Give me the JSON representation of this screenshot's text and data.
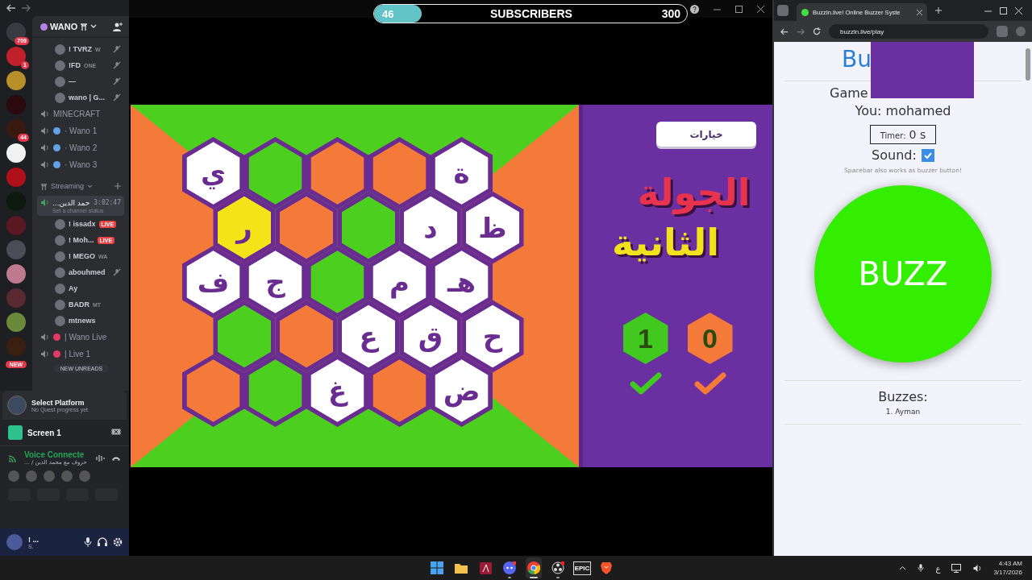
{
  "discord": {
    "server_name": "WANO",
    "servers": [
      {
        "color": "#3a3b40",
        "badge": "709"
      },
      {
        "color": "#c0202a",
        "badge": "1"
      },
      {
        "color": "#b8902a"
      },
      {
        "color": "#2a0a0c"
      },
      {
        "color": "#3a1a10",
        "badge": "44"
      },
      {
        "color": "#f2f2f2"
      },
      {
        "color": "#b0101a"
      },
      {
        "color": "#0e1a10"
      },
      {
        "color": "#5a1820"
      },
      {
        "color": "#4a4d56"
      },
      {
        "color": "#c07a90"
      },
      {
        "color": "#5a2a30"
      },
      {
        "color": "#6a8a3a"
      },
      {
        "color": "#3a2010"
      }
    ],
    "new_pill": "NEW",
    "rows": [
      {
        "kind": "user",
        "name": "! TVRZ",
        "tag": "W",
        "muted": true
      },
      {
        "kind": "user",
        "name": "!FD",
        "tag": "ONE",
        "muted": true
      },
      {
        "kind": "user",
        "name": "—",
        "muted": true
      },
      {
        "kind": "user",
        "name": "wano | G...",
        "muted": true
      },
      {
        "kind": "voice",
        "name": "MINECRAFT"
      },
      {
        "kind": "voice",
        "name": "· Wano 1",
        "color": "#5fa3e6"
      },
      {
        "kind": "voice",
        "name": "· Wano 2",
        "color": "#5fa3e6"
      },
      {
        "kind": "voice",
        "name": "· Wano 3",
        "color": "#5fa3e6"
      },
      {
        "kind": "category",
        "name": "Streaming"
      },
      {
        "kind": "current",
        "name": "...حمد الدين",
        "time": "3:02:47",
        "status": "Set a channel status"
      },
      {
        "kind": "user",
        "name": "! issadx",
        "live": "LIVE",
        "muted": false
      },
      {
        "kind": "user",
        "name": "! Moh...",
        "live": "LIVE",
        "muted": false
      },
      {
        "kind": "user",
        "name": "! MEGO",
        "tag": "WA",
        "muted": false
      },
      {
        "kind": "user",
        "name": "abouhmed",
        "muted": true
      },
      {
        "kind": "user",
        "name": "Ay",
        "muted": false
      },
      {
        "kind": "user",
        "name": "BADR",
        "tag": "MT",
        "muted": false
      },
      {
        "kind": "user",
        "name": "mtnews",
        "muted": false
      },
      {
        "kind": "voice",
        "name": "| Wano Live",
        "color": "#e23a64"
      },
      {
        "kind": "voice",
        "name": "| Live 1",
        "color": "#e23a64"
      }
    ],
    "unreads": "NEW UNREADS",
    "quest": {
      "title": "Select Platform",
      "subtitle": "No Quest progress yet"
    },
    "screen": "Screen 1",
    "voice": {
      "title": "Voice Connecte",
      "subtitle": "... / حروف مع محمد الدين"
    },
    "user": {
      "name": "! ...",
      "status": "S."
    }
  },
  "subscribers": {
    "current": "46",
    "label": "SUBSCRIBERS",
    "goal": "300",
    "level": 0.153
  },
  "board": {
    "rows": [
      [
        {
          "kind": "letter",
          "letter": "ي",
          "selected": false
        },
        {
          "kind": "green",
          "selected": false
        },
        {
          "kind": "orange",
          "selected": false
        },
        {
          "kind": "orange",
          "selected": false
        },
        {
          "kind": "letter",
          "letter": "ة",
          "selected": false
        }
      ],
      [
        {
          "kind": "letter",
          "letter": "ر",
          "selected": true
        },
        {
          "kind": "orange",
          "selected": false
        },
        {
          "kind": "green",
          "selected": false
        },
        {
          "kind": "letter",
          "letter": "د",
          "selected": false
        },
        {
          "kind": "letter",
          "letter": "ظ",
          "selected": false
        }
      ],
      [
        {
          "kind": "letter",
          "letter": "ف",
          "selected": false
        },
        {
          "kind": "letter",
          "letter": "ج",
          "selected": false
        },
        {
          "kind": "green",
          "selected": false
        },
        {
          "kind": "letter",
          "letter": "م",
          "selected": false
        },
        {
          "kind": "letter",
          "letter": "هـ",
          "selected": false
        }
      ],
      [
        {
          "kind": "green",
          "selected": false
        },
        {
          "kind": "orange",
          "selected": false
        },
        {
          "kind": "letter",
          "letter": "ع",
          "selected": false
        },
        {
          "kind": "letter",
          "letter": "ق",
          "selected": false
        },
        {
          "kind": "letter",
          "letter": "ح",
          "selected": false
        }
      ],
      [
        {
          "kind": "orange",
          "selected": false
        },
        {
          "kind": "green",
          "selected": false
        },
        {
          "kind": "letter",
          "letter": "غ",
          "selected": false
        },
        {
          "kind": "orange",
          "selected": false
        },
        {
          "kind": "letter",
          "letter": "ض",
          "selected": false
        }
      ]
    ]
  },
  "panel": {
    "options_button": "خيارات",
    "title_lines": [
      {
        "text": "الجولة",
        "color": "#e8334f"
      },
      {
        "text": "الثانية",
        "color": "#f2e21d"
      }
    ],
    "scores": [
      {
        "score": "1",
        "color": "#41c91f"
      },
      {
        "score": "0",
        "color": "#f47a3a"
      }
    ]
  },
  "browser": {
    "tab_title": "BuzzIn.live! Online Buzzer Syste",
    "address": "buzzin.live/play",
    "page": {
      "title": "Bu",
      "game": "Game",
      "you": "You: mohamed",
      "timer_label": "Timer:",
      "timer_value": "0 s",
      "sound_label": "Sound:",
      "sound_on": true,
      "hint": "Spacebar also works as buzzer button!",
      "buzz": "BUZZ",
      "buzzes_title": "Buzzes:",
      "buzzes": [
        "1. Ayman"
      ]
    }
  },
  "taskbar": {
    "apps": [
      {
        "kind": "windows",
        "running": false,
        "selected": false
      },
      {
        "kind": "folder",
        "running": false,
        "selected": false
      },
      {
        "kind": "affinity",
        "running": false,
        "selected": false
      },
      {
        "kind": "discord",
        "running": true,
        "selected": false
      },
      {
        "kind": "chrome",
        "running": true,
        "selected": true
      },
      {
        "kind": "obs",
        "running": true,
        "selected": false
      },
      {
        "kind": "epic",
        "label": "EPIC",
        "running": false,
        "selected": false
      },
      {
        "kind": "brave",
        "running": false,
        "selected": false
      }
    ],
    "language": "ع",
    "time": "4:43 AM",
    "date": "3/17/2026"
  }
}
